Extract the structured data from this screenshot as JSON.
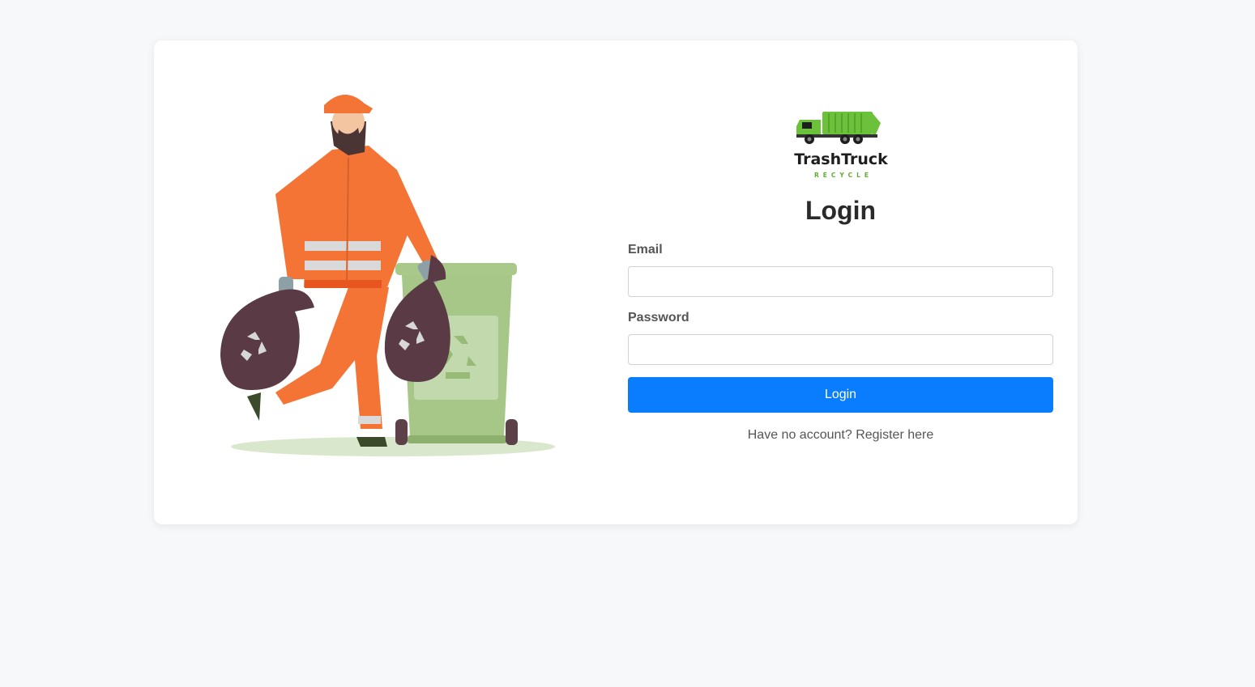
{
  "brand": {
    "name": "TrashTruck",
    "tagline": "RECYCLE",
    "colors": {
      "truck_green": "#6cc13a",
      "accent_blue": "#0a7dff"
    }
  },
  "login_form": {
    "title": "Login",
    "email_label": "Email",
    "email_value": "",
    "password_label": "Password",
    "password_value": "",
    "submit_label": "Login",
    "register_prompt": "Have no account?",
    "register_link": "Register here"
  },
  "illustration": {
    "icon": "worker-with-trash-bags-and-recycle-bin"
  }
}
